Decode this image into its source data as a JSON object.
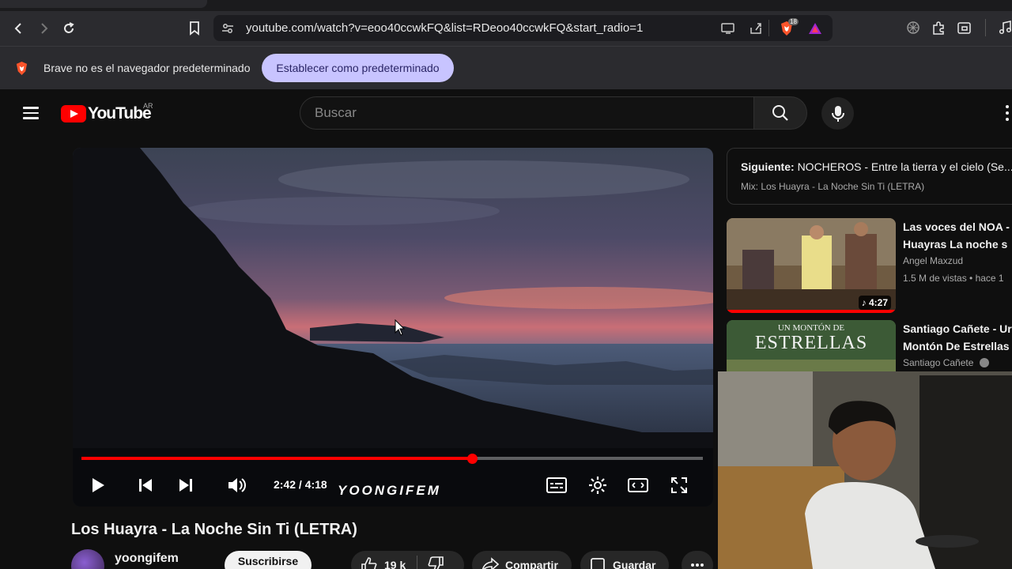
{
  "browser": {
    "url": "youtube.com/watch?v=eoo40ccwkFQ&list=RDeoo40ccwkFQ&start_radio=1",
    "extension_badge": "18",
    "infobar_text": "Brave no es el navegador predeterminado",
    "infobar_button": "Establecer como predeterminado"
  },
  "youtube": {
    "logo_text": "YouTube",
    "country": "AR",
    "search_placeholder": "Buscar"
  },
  "player": {
    "current_time": "2:42",
    "duration": "4:18",
    "time_display": "2:42 / 4:18",
    "progress_fraction": 0.628,
    "watermark": "YOONGIFEM"
  },
  "video": {
    "title": "Los Huayra - La Noche Sin Ti (LETRA)",
    "channel": "yoongifem",
    "subscribe_label": "Suscribirse",
    "likes": "19 k",
    "share_label": "Compartir",
    "save_label": "Guardar"
  },
  "sidebar": {
    "next_label": "Siguiente:",
    "next_title": "NOCHEROS - Entre la tierra y el cielo (Se...",
    "mix_label": "Mix: Los Huayra - La Noche Sin Ti (LETRA)",
    "recommendations": [
      {
        "title_line1": "Las voces del NOA -",
        "title_line2": "Huayras   La noche s",
        "channel": "Angel Maxzud",
        "stats": "1.5 M de vistas • hace 1",
        "duration": "4:27"
      },
      {
        "title_line1": "Santiago Cañete - Ur",
        "title_line2": "Montón De Estrellas",
        "channel": "Santiago Cañete",
        "thumb_text_top": "UN MONTÓN DE",
        "thumb_text_main": "ESTRELLAS"
      }
    ]
  },
  "colors": {
    "accent_red": "#ff0000",
    "bg": "#0f0f0f",
    "infobar_button_bg": "#c8c4ff"
  }
}
